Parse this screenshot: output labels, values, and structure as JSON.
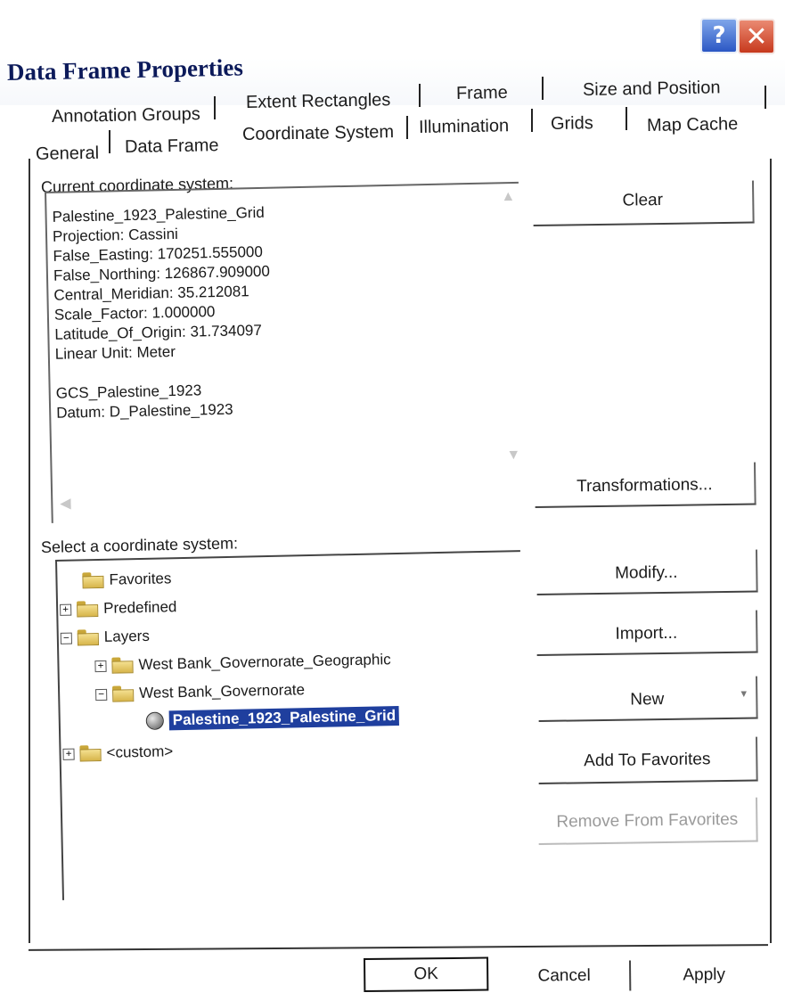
{
  "window": {
    "title": "Data Frame Properties",
    "help_glyph": "?",
    "close_glyph": "✕"
  },
  "tabs": {
    "row1": [
      "Annotation Groups",
      "Extent Rectangles",
      "Frame",
      "Size and Position"
    ],
    "row2": [
      "General",
      "Data Frame",
      "Coordinate System",
      "Illumination",
      "Grids",
      "Map Cache"
    ],
    "active": "Coordinate System"
  },
  "current": {
    "label": "Current coordinate system:",
    "text": "Palestine_1923_Palestine_Grid\nProjection: Cassini\nFalse_Easting: 170251.555000\nFalse_Northing: 126867.909000\nCentral_Meridian: 35.212081\nScale_Factor: 1.000000\nLatitude_Of_Origin: 31.734097\nLinear Unit: Meter\n\nGCS_Palestine_1923\nDatum: D_Palestine_1923"
  },
  "select": {
    "label": "Select a coordinate system:",
    "tree": {
      "favorites": "Favorites",
      "predefined": "Predefined",
      "layers": "Layers",
      "layer1": "West Bank_Governorate_Geographic",
      "layer2": "West Bank_Governorate",
      "layer2_child": "Palestine_1923_Palestine_Grid",
      "custom": "<custom>"
    }
  },
  "buttons": {
    "clear": "Clear",
    "transformations": "Transformations...",
    "modify": "Modify...",
    "import": "Import...",
    "new": "New",
    "add_favorites": "Add To Favorites",
    "remove_favorites": "Remove From Favorites"
  },
  "footer": {
    "ok": "OK",
    "cancel": "Cancel",
    "apply": "Apply"
  },
  "icons": {
    "folder": "folder-icon",
    "globe": "globe-icon",
    "expand": "+",
    "collapse": "−"
  }
}
